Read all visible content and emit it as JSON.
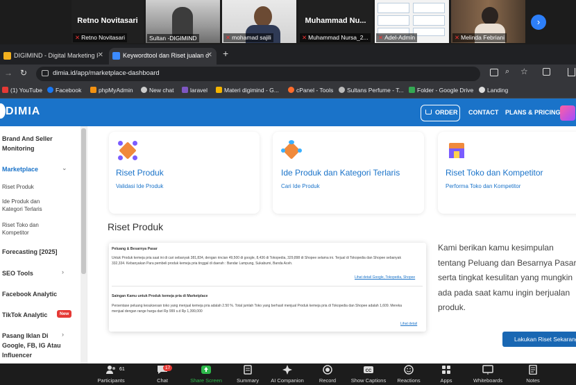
{
  "zoom": {
    "participants": [
      {
        "display_name": "Retno Novitasari",
        "label": "Retno Novitasari"
      },
      {
        "label": "Sultan -DIGIMIND"
      },
      {
        "label": "mohamad sajili"
      },
      {
        "display_name": "Muhammad Nu...",
        "label": "Muhammad Nursa_2..."
      },
      {
        "label": "Adel-Admin"
      },
      {
        "label": "Melinda Febriani"
      }
    ],
    "toolbar": [
      {
        "label": "Participants",
        "count": "61"
      },
      {
        "label": "Chat",
        "count": "17"
      },
      {
        "label": "Share Screen"
      },
      {
        "label": "Summary"
      },
      {
        "label": "AI Companion"
      },
      {
        "label": "Record"
      },
      {
        "label": "Show Captions"
      },
      {
        "label": "Reactions"
      },
      {
        "label": "Apps"
      },
      {
        "label": "Whiteboards"
      },
      {
        "label": "Notes"
      }
    ]
  },
  "browser": {
    "tabs": [
      {
        "title": "DIGIMIND - Digital Marketing I"
      },
      {
        "title": "Keywordtool dan Riset jualan o"
      }
    ],
    "url": "dimia.id/app/marketplace-dashboard",
    "bookmarks": [
      "(1) YouTube",
      "Facebook",
      "phpMyAdmin",
      "New chat",
      "laravel",
      "Materi digimind - G...",
      "cPanel - Tools",
      "Sultans Perfume - T...",
      "Folder - Google Drive",
      "Landing"
    ]
  },
  "site": {
    "logo": "DIMIA",
    "nav": {
      "order": "ORDER",
      "contact": "CONTACT",
      "plans": "PLANS & PRICING"
    },
    "sidebar": {
      "brand_seller": "Brand And Seller Monitoring",
      "marketplace": "Marketplace",
      "sub_items": [
        "Riset Produk",
        "Ide Produk dan Kategori Terlaris",
        "Riset Toko dan Kompetitor"
      ],
      "forecasting": "Forecasting [2025]",
      "seo_tools": "SEO Tools",
      "facebook_analytic": "Facebook Analytic",
      "tiktok_analytic": "TikTok Analytic",
      "new_badge": "New",
      "pasang_iklan": "Pasang Iklan Di Google, FB, IG Atau Influencer"
    },
    "cards": [
      {
        "title": "Riset Produk",
        "subtitle": "Validasi Ide Produk"
      },
      {
        "title": "Ide Produk dan Kategori Terlaris",
        "subtitle": "Cari Ide Produk"
      },
      {
        "title": "Riset Toko dan Kompetitor",
        "subtitle": "Performa Toko dan Kompetitor"
      }
    ],
    "section_title": "Riset Produk",
    "preview": {
      "title1": "Peluang & Besarnya Pasar",
      "text1": "Untuk Produk kemeja pria saat ini di cari sebanyak 381,834, dengan rincian 49,500 di google, 8,436 di Tokopedia, 329,898 di Shopee selama ini. Terjual di Tokopedia dan Shopee sebanyak 332,334. Kebanyakan Para pembeli produk kemeja pria tinggal di daerah : Bandar Lampung, Sukabumi, Banda Aceh.",
      "links1": "Lihat detail Google, Tokopedia, Shopee",
      "title2": "Saingan Kamu untuk Produk kemeja pria di Marketplace",
      "text2": "Persentase peluang kesuksesan toko yang menjual kemeja pria adalah 2.50 %. Total jumlah Toko yang berhasil menjual Produk kemeja pria di Tokopedia dan Shopee adalah 1,609. Mereka menjual dengan range harga dari Rp 999 s.d Rp 1,399,000",
      "link2": "Lihat detail"
    },
    "description": "Kami berikan kamu kesimpulan tentang Peluang dan Besarnya Pasar serta tingkat kesulitan yang mungkin ada pada saat kamu ingin berjualan produk.",
    "cta": "Lakukan Riset Sekarang"
  },
  "colors": {
    "brand": "#1a73c9",
    "zoom_bg": "#1c1c1c",
    "badge": "#e53935",
    "share": "#2db84a"
  }
}
